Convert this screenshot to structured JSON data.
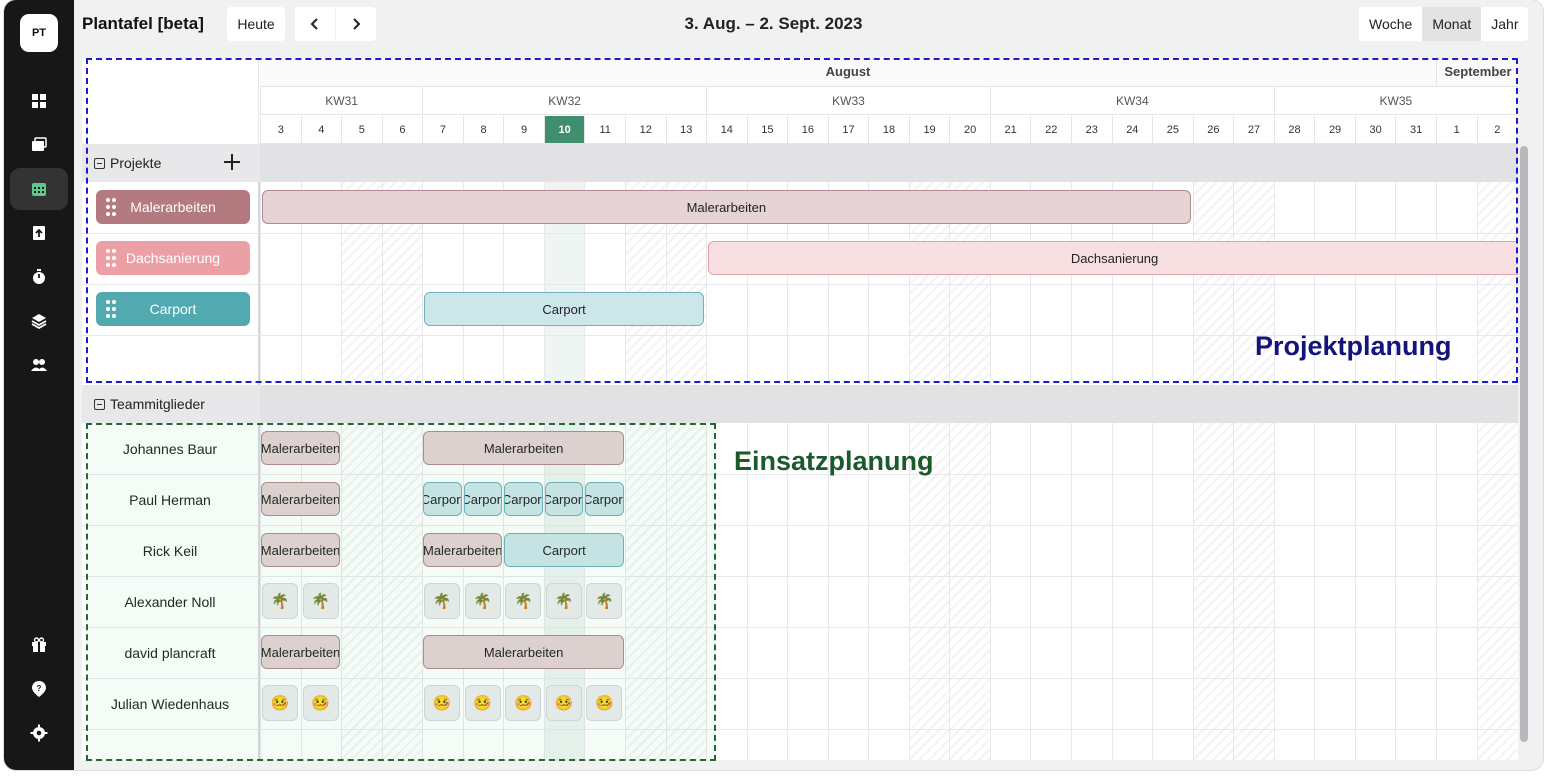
{
  "app": {
    "logo": "PT",
    "title": "Plantafel [beta]"
  },
  "toolbar": {
    "today_label": "Heute",
    "prev_icon": "chevron-left-icon",
    "next_icon": "chevron-right-icon",
    "period": "3. Aug. – 2. Sept. 2023"
  },
  "views": [
    {
      "label": "Woche"
    },
    {
      "label": "Monat",
      "selected": true
    },
    {
      "label": "Jahr"
    }
  ],
  "sidebar": [
    {
      "icon": "dashboard-icon"
    },
    {
      "icon": "folders-icon"
    },
    {
      "icon": "calendar-icon",
      "active": true
    },
    {
      "icon": "document-upload-icon"
    },
    {
      "icon": "stopwatch-icon"
    },
    {
      "icon": "layers-icon"
    },
    {
      "icon": "team-icon"
    },
    {
      "icon": "gift-icon"
    },
    {
      "icon": "help-icon"
    },
    {
      "icon": "settings-icon"
    }
  ],
  "timeline": {
    "months": [
      {
        "label": "August"
      },
      {
        "label": "September"
      }
    ],
    "weeks": [
      "KW31",
      "KW32",
      "KW33",
      "KW34",
      "KW35"
    ],
    "days": [
      "3",
      "4",
      "5",
      "6",
      "7",
      "8",
      "9",
      "10",
      "11",
      "12",
      "13",
      "14",
      "15",
      "16",
      "17",
      "18",
      "19",
      "20",
      "21",
      "22",
      "23",
      "24",
      "25",
      "26",
      "27",
      "28",
      "29",
      "30",
      "31",
      "1",
      "2"
    ],
    "today": "10"
  },
  "projects_group": {
    "label": "Projekte",
    "add_icon": "plus-icon"
  },
  "projects": [
    {
      "name": "Malerarbeiten",
      "color": "#b37a80",
      "bar": {
        "label": "Malerarbeiten",
        "from": "3",
        "to": "25"
      }
    },
    {
      "name": "Dachsanierung",
      "color": "#eba0a5",
      "bar": {
        "label": "Dachsanierung",
        "from": "14",
        "to": "2"
      }
    },
    {
      "name": "Carport",
      "color": "#52a9b0",
      "bar": {
        "label": "Carport",
        "from": "7",
        "to": "13"
      }
    }
  ],
  "team_group": {
    "label": "Teammitglieder"
  },
  "members": [
    {
      "name": "Johannes Baur",
      "items": [
        {
          "label": "Malerarbeiten",
          "type": "mal",
          "from": "3",
          "to": "4"
        },
        {
          "label": "Malerarbeiten",
          "type": "mal",
          "from": "7",
          "to": "11"
        }
      ]
    },
    {
      "name": "Paul Herman",
      "items": [
        {
          "label": "Malerarbeiten",
          "type": "mal",
          "from": "3",
          "to": "4"
        },
        {
          "label": "Carport",
          "type": "car",
          "from": "7",
          "to": "7"
        },
        {
          "label": "Carport",
          "type": "car",
          "from": "8",
          "to": "8"
        },
        {
          "label": "Carport",
          "type": "car",
          "from": "9",
          "to": "9"
        },
        {
          "label": "Carport",
          "type": "car",
          "from": "10",
          "to": "10"
        },
        {
          "label": "Carport",
          "type": "car",
          "from": "11",
          "to": "11"
        }
      ]
    },
    {
      "name": "Rick Keil",
      "items": [
        {
          "label": "Malerarbeiten",
          "type": "mal",
          "from": "3",
          "to": "4"
        },
        {
          "label": "Malerarbeiten",
          "type": "mal",
          "from": "7",
          "to": "8"
        },
        {
          "label": "Carport",
          "type": "car",
          "from": "9",
          "to": "11"
        }
      ]
    },
    {
      "name": "Alexander Noll",
      "absences": {
        "emoji": "🌴",
        "days": [
          "3",
          "4",
          "7",
          "8",
          "9",
          "10",
          "11"
        ]
      }
    },
    {
      "name": "david plancraft",
      "items": [
        {
          "label": "Malerarbeiten",
          "type": "mal",
          "from": "3",
          "to": "4"
        },
        {
          "label": "Malerarbeiten",
          "type": "mal",
          "from": "7",
          "to": "11"
        }
      ]
    },
    {
      "name": "Julian Wiedenhaus",
      "absences": {
        "emoji": "🤒",
        "days": [
          "3",
          "4",
          "7",
          "8",
          "9",
          "10",
          "11"
        ]
      }
    }
  ],
  "annotations": {
    "projects": "Projektplanung",
    "team": "Einsatzplanung"
  }
}
